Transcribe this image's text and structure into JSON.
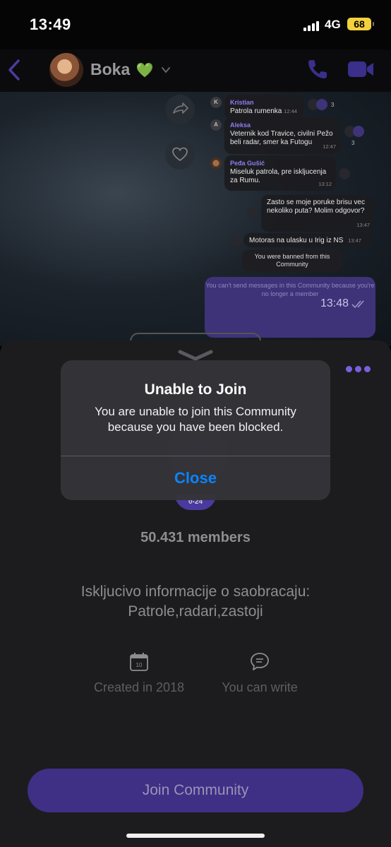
{
  "status_bar": {
    "time": "13:49",
    "network": "4G",
    "battery": "68"
  },
  "header": {
    "name": "Boka",
    "name_emoji": "💚"
  },
  "chat": {
    "messages": [
      {
        "initial": "K",
        "sender": "Kristian",
        "text": "Patrola rumenka",
        "time": "12:44",
        "reactions": "3"
      },
      {
        "initial": "A",
        "sender": "Aleksa",
        "text": "Veternik kod Travice, civilni Pežo beli radar, smer ka Futogu",
        "time": "12:47",
        "reactions": "3"
      },
      {
        "sender": "Peđa Gušić",
        "text": "Miseluk patrola, pre iskljucenja za Rumu.",
        "time": "13:12"
      },
      {
        "text": "Zasto se moje poruke brisu vec nekoliko puta? Molim odgovor?",
        "time": "13:47"
      },
      {
        "text": "Motoras na ulasku u Irig iz NS",
        "time": "13:47"
      }
    ],
    "banned_notice": "You were banned from this Community",
    "cant_send_notice": "You can't send messages in this Community because you're no longer a member",
    "last_time": "13:48"
  },
  "community": {
    "age": "0-24",
    "members": "50.431 members",
    "description": "Iskljucivo informacije o saobracaju: Patrole,radari,zastoji",
    "calendar_day": "10",
    "created_label": "Created in 2018",
    "write_label": "You can write",
    "join_button": "Join Community"
  },
  "alert": {
    "title": "Unable to Join",
    "message": "You are unable to join this Community because you have been blocked.",
    "close_button": "Close"
  },
  "colors": {
    "accent": "#7b5fe0",
    "join_button": "#3f2f85",
    "alert_button": "#0a84ff"
  }
}
